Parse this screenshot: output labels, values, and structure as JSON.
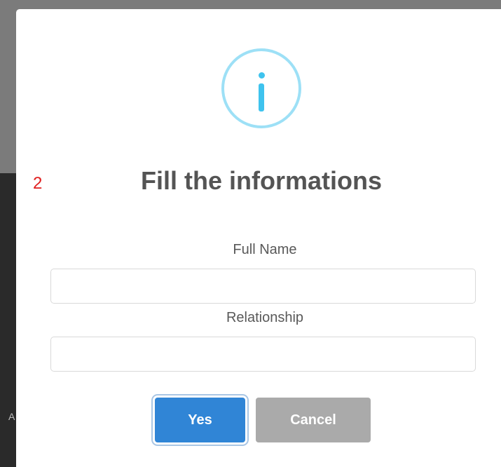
{
  "backdrop": {
    "stray_text": "A"
  },
  "modal": {
    "icon": "info-icon",
    "step_number": "2",
    "title": "Fill the informations",
    "fields": [
      {
        "label": "Full Name",
        "value": "",
        "placeholder": ""
      },
      {
        "label": "Relationship",
        "value": "",
        "placeholder": ""
      }
    ],
    "buttons": {
      "confirm_label": "Yes",
      "cancel_label": "Cancel"
    }
  },
  "colors": {
    "confirm": "#3085d6",
    "cancel": "#aaaaaa",
    "info_ring": "#9de0f6",
    "info_glyph": "#3fc3ee",
    "step_number": "#e01f1f",
    "title": "#545454"
  }
}
